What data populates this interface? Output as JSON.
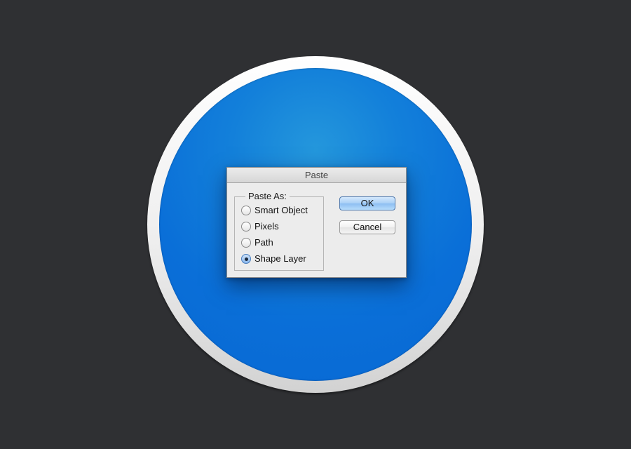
{
  "dialog": {
    "title": "Paste",
    "group_label": "Paste As:",
    "options": [
      {
        "label": "Smart Object",
        "selected": false
      },
      {
        "label": "Pixels",
        "selected": false
      },
      {
        "label": "Path",
        "selected": false
      },
      {
        "label": "Shape Layer",
        "selected": true
      }
    ],
    "ok_label": "OK",
    "cancel_label": "Cancel"
  },
  "colors": {
    "background": "#2f3033",
    "disc_blue": "#0a6fd8",
    "ring": "#eeeeee",
    "default_button": "#a9cff6"
  }
}
